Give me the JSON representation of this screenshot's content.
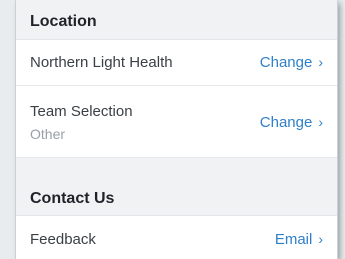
{
  "location": {
    "header": "Location",
    "rows": [
      {
        "label": "Northern Light Health",
        "action": "Change",
        "chevron": "›"
      },
      {
        "label": "Team Selection",
        "sublabel": "Other",
        "action": "Change",
        "chevron": "›"
      }
    ]
  },
  "contact": {
    "header": "Contact Us",
    "rows": [
      {
        "label": "Feedback",
        "action": "Email",
        "chevron": "›"
      }
    ]
  },
  "colors": {
    "action": "#2f80c8",
    "header_bg": "#f1f2f4"
  }
}
